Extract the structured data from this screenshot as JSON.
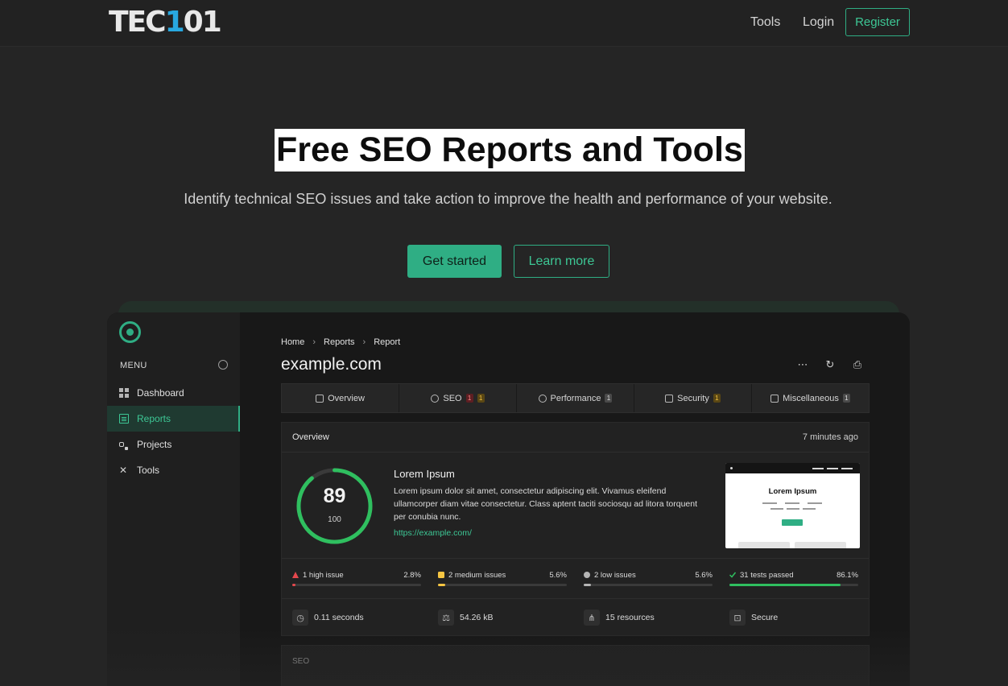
{
  "brand": {
    "logo_main": "TEC",
    "logo_accent": "1",
    "logo_end": "01"
  },
  "nav": {
    "tools": "Tools",
    "login": "Login",
    "register": "Register"
  },
  "hero": {
    "title": "Free SEO Reports and Tools",
    "subtitle": "Identify technical SEO issues and take action to improve the health and performance of your website.",
    "cta_primary": "Get started",
    "cta_secondary": "Learn more"
  },
  "app": {
    "menu_label": "MENU",
    "sidebar": [
      {
        "label": "Dashboard",
        "icon": "grid-icon"
      },
      {
        "label": "Reports",
        "icon": "document-icon",
        "active": true
      },
      {
        "label": "Projects",
        "icon": "projects-icon"
      },
      {
        "label": "Tools",
        "icon": "tools-icon"
      }
    ],
    "breadcrumb": [
      "Home",
      "Reports",
      "Report"
    ],
    "site": "example.com",
    "tabs": [
      {
        "label": "Overview",
        "badges": []
      },
      {
        "label": "SEO",
        "badges": [
          "1",
          "1"
        ]
      },
      {
        "label": "Performance",
        "badges": [
          "1"
        ]
      },
      {
        "label": "Security",
        "badges": [
          "1"
        ]
      },
      {
        "label": "Miscellaneous",
        "badges": [
          "1"
        ]
      }
    ],
    "overview": {
      "title": "Overview",
      "time": "7 minutes ago",
      "score": "89",
      "score_max": "100",
      "score_fraction": 0.89,
      "heading": "Lorem Ipsum",
      "description": "Lorem ipsum dolor sit amet, consectetur adipiscing elit. Vivamus eleifend ullamcorper diam vitae consectetur. Class aptent taciti sociosqu ad litora torquent per conubia nunc.",
      "url": "https://example.com/",
      "thumbnail_title": "Lorem Ipsum"
    },
    "stats": [
      {
        "label": "1 high issue",
        "pct": "2.8%",
        "value": 2.8,
        "color": "#e5484d"
      },
      {
        "label": "2 medium issues",
        "pct": "5.6%",
        "value": 5.6,
        "color": "#f5c542"
      },
      {
        "label": "2 low issues",
        "pct": "5.6%",
        "value": 5.6,
        "color": "#b5b5b5"
      },
      {
        "label": "31 tests passed",
        "pct": "86.1%",
        "value": 86.1,
        "color": "#2fbf5f"
      }
    ],
    "metrics": [
      {
        "label": "0.11 seconds",
        "icon": "timer-icon"
      },
      {
        "label": "54.26 kB",
        "icon": "scale-icon"
      },
      {
        "label": "15 resources",
        "icon": "network-icon"
      },
      {
        "label": "Secure",
        "icon": "lock-icon"
      }
    ],
    "seo_section": "SEO"
  },
  "colors": {
    "accent": "#2fae84",
    "background": "#252525",
    "panel": "#222222"
  }
}
